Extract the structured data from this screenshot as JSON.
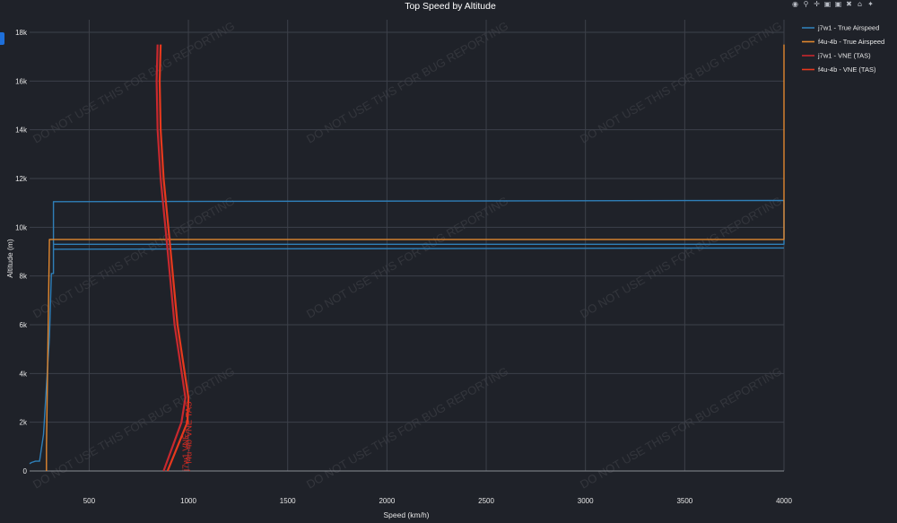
{
  "colors": {
    "background": "#1f2229",
    "grid": "#3d414a",
    "accent": "#1e6fd9"
  },
  "modebar": {
    "icons": [
      "camera-icon",
      "zoom-icon",
      "pan-icon",
      "zoom-in-icon",
      "zoom-out-icon",
      "autoscale-icon",
      "reset-axes-icon",
      "plotly-logo-icon"
    ]
  },
  "watermark": "DO NOT USE THIS FOR BUG REPORTING",
  "chart_data": {
    "type": "line",
    "title": "Top Speed by Altitude",
    "xlabel": "Speed (km/h)",
    "ylabel": "Altitude (m)",
    "xlim": [
      200,
      4000
    ],
    "ylim": [
      0,
      18000
    ],
    "xticks": [
      500,
      1000,
      1500,
      2000,
      2500,
      3000,
      3500,
      4000
    ],
    "xtick_labels": [
      "500",
      "1000",
      "1500",
      "2000",
      "2500",
      "3000",
      "3500",
      "4000"
    ],
    "yticks": [
      0,
      2000,
      4000,
      6000,
      8000,
      10000,
      12000,
      14000,
      16000,
      18000
    ],
    "ytick_labels": [
      "0",
      "2k",
      "4k",
      "6k",
      "8k",
      "10k",
      "12k",
      "14k",
      "16k",
      "18k"
    ],
    "grid": true,
    "legend_position": "right",
    "series": [
      {
        "name": "j7w1 - True Airspeed",
        "color": "#2f7fb8",
        "x": [
          200,
          210,
          230,
          250,
          270,
          300,
          310,
          320,
          320,
          320,
          320,
          4000,
          4000,
          320,
          320,
          4000
        ],
        "y": [
          300,
          350,
          400,
          400,
          1500,
          5500,
          8100,
          8100,
          9100,
          9500,
          11050,
          11100,
          9300,
          9300,
          9100,
          9150
        ]
      },
      {
        "name": "f4u-4b - True Airspeed",
        "color": "#e0872f",
        "x": [
          285,
          285,
          300,
          4000,
          4000
        ],
        "y": [
          0,
          1000,
          9500,
          9500,
          17500
        ]
      },
      {
        "name": "j7w1 - VNE (TAS)",
        "color": "#c8282e",
        "x": [
          875,
          965,
          985,
          930,
          890,
          860,
          845,
          840,
          845
        ],
        "y": [
          0,
          2000,
          3000,
          6000,
          9500,
          12000,
          14000,
          16000,
          17500
        ]
      },
      {
        "name": "f4u-4b - VNE (TAS)",
        "color": "#e8391d",
        "x": [
          895,
          995,
          1000,
          945,
          905,
          875,
          860,
          855,
          860
        ],
        "y": [
          0,
          2000,
          3000,
          6000,
          9500,
          12000,
          14000,
          16000,
          17500
        ]
      }
    ],
    "annotations": [
      {
        "text": "j7w1 VNE",
        "color": "#c8282e",
        "x": 1000,
        "y": 0
      },
      {
        "text": "f4u-4b VNE TAS",
        "color": "#e8391d",
        "x": 1015,
        "y": 300
      }
    ]
  }
}
